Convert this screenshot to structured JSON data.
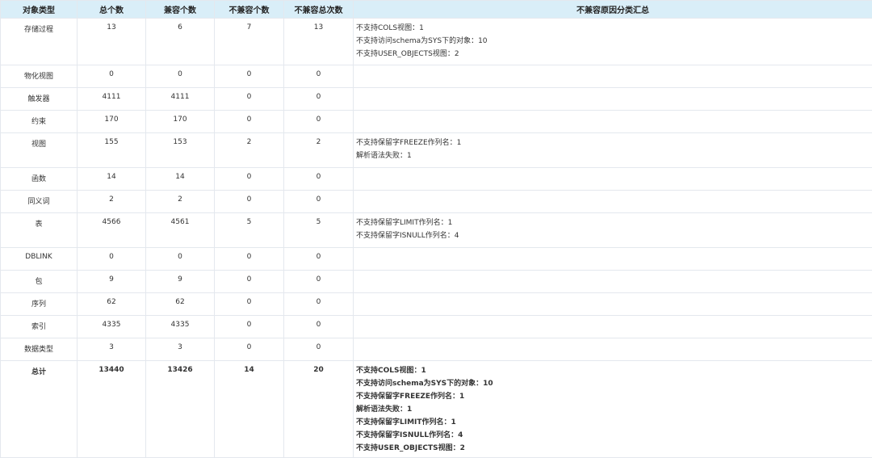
{
  "columns": [
    "对象类型",
    "总个数",
    "兼容个数",
    "不兼容个数",
    "不兼容总次数",
    "不兼容原因分类汇总"
  ],
  "rows": [
    {
      "type": "存储过程",
      "total": "13",
      "compatible": "6",
      "incompatible": "7",
      "incompatible_count": "13",
      "reasons": [
        "不支持COLS视图：1",
        "不支持访问schema为SYS下的对象：10",
        "不支持USER_OBJECTS视图：2"
      ]
    },
    {
      "type": "物化视图",
      "total": "0",
      "compatible": "0",
      "incompatible": "0",
      "incompatible_count": "0",
      "reasons": []
    },
    {
      "type": "触发器",
      "total": "4111",
      "compatible": "4111",
      "incompatible": "0",
      "incompatible_count": "0",
      "reasons": []
    },
    {
      "type": "约束",
      "total": "170",
      "compatible": "170",
      "incompatible": "0",
      "incompatible_count": "0",
      "reasons": []
    },
    {
      "type": "视图",
      "total": "155",
      "compatible": "153",
      "incompatible": "2",
      "incompatible_count": "2",
      "reasons": [
        "不支持保留字FREEZE作列名：1",
        "解析语法失败：1"
      ]
    },
    {
      "type": "函数",
      "total": "14",
      "compatible": "14",
      "incompatible": "0",
      "incompatible_count": "0",
      "reasons": []
    },
    {
      "type": "同义词",
      "total": "2",
      "compatible": "2",
      "incompatible": "0",
      "incompatible_count": "0",
      "reasons": []
    },
    {
      "type": "表",
      "total": "4566",
      "compatible": "4561",
      "incompatible": "5",
      "incompatible_count": "5",
      "reasons": [
        "不支持保留字LIMIT作列名：1",
        "不支持保留字ISNULL作列名：4"
      ]
    },
    {
      "type": "DBLINK",
      "total": "0",
      "compatible": "0",
      "incompatible": "0",
      "incompatible_count": "0",
      "reasons": []
    },
    {
      "type": "包",
      "total": "9",
      "compatible": "9",
      "incompatible": "0",
      "incompatible_count": "0",
      "reasons": []
    },
    {
      "type": "序列",
      "total": "62",
      "compatible": "62",
      "incompatible": "0",
      "incompatible_count": "0",
      "reasons": []
    },
    {
      "type": "索引",
      "total": "4335",
      "compatible": "4335",
      "incompatible": "0",
      "incompatible_count": "0",
      "reasons": []
    },
    {
      "type": "数据类型",
      "total": "3",
      "compatible": "3",
      "incompatible": "0",
      "incompatible_count": "0",
      "reasons": []
    }
  ],
  "total_row": {
    "type": "总计",
    "total": "13440",
    "compatible": "13426",
    "incompatible": "14",
    "incompatible_count": "20",
    "reasons": [
      "不支持COLS视图：1",
      "不支持访问schema为SYS下的对象：10",
      "不支持保留字FREEZE作列名：1",
      "解析语法失败：1",
      "不支持保留字LIMIT作列名：1",
      "不支持保留字ISNULL作列名：4",
      "不支持USER_OBJECTS视图：2"
    ]
  }
}
